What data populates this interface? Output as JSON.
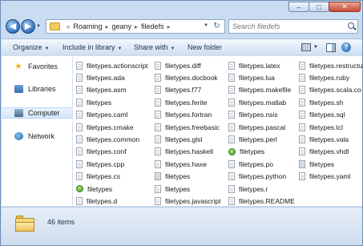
{
  "window": {
    "caption_buttons": {
      "minimize": "–",
      "maximize": "□",
      "close": "✕"
    }
  },
  "address": {
    "crumbs": [
      "Roaming",
      "geany",
      "filedefs"
    ],
    "search_placeholder": "Search filedefs"
  },
  "toolbar": {
    "organize": "Organize",
    "include_in_library": "Include in library",
    "share_with": "Share with",
    "new_folder": "New folder"
  },
  "nav": {
    "favorites": "Favorites",
    "libraries": "Libraries",
    "computer": "Computer",
    "network": "Network"
  },
  "files": [
    [
      {
        "name": "filetypes.actionscript",
        "icon": "file"
      },
      {
        "name": "filetypes.ada",
        "icon": "file"
      },
      {
        "name": "filetypes.asm",
        "icon": "file"
      },
      {
        "name": "filetypes",
        "icon": "file"
      },
      {
        "name": "filetypes.caml",
        "icon": "file"
      },
      {
        "name": "filetypes.cmake",
        "icon": "file"
      },
      {
        "name": "filetypes.common",
        "icon": "file"
      },
      {
        "name": "filetypes.conf",
        "icon": "file"
      },
      {
        "name": "filetypes.cpp",
        "icon": "file"
      },
      {
        "name": "filetypes.cs",
        "icon": "file"
      },
      {
        "name": "filetypes",
        "icon": "green"
      },
      {
        "name": "filetypes.d",
        "icon": "file"
      }
    ],
    [
      {
        "name": "filetypes.diff",
        "icon": "file"
      },
      {
        "name": "filetypes.docbook",
        "icon": "file"
      },
      {
        "name": "filetypes.f77",
        "icon": "file"
      },
      {
        "name": "filetypes.ferite",
        "icon": "file"
      },
      {
        "name": "filetypes.fortran",
        "icon": "file"
      },
      {
        "name": "filetypes.freebasic",
        "icon": "file"
      },
      {
        "name": "filetypes.glsl",
        "icon": "file"
      },
      {
        "name": "filetypes.haskell",
        "icon": "file"
      },
      {
        "name": "filetypes.haxe",
        "icon": "file"
      },
      {
        "name": "filetypes",
        "icon": "gear"
      },
      {
        "name": "filetypes",
        "icon": "file"
      },
      {
        "name": "filetypes.javascript",
        "icon": "file"
      }
    ],
    [
      {
        "name": "filetypes.latex",
        "icon": "file"
      },
      {
        "name": "filetypes.lua",
        "icon": "file"
      },
      {
        "name": "filetypes.makefile",
        "icon": "file"
      },
      {
        "name": "filetypes.matlab",
        "icon": "file"
      },
      {
        "name": "filetypes.nsis",
        "icon": "file"
      },
      {
        "name": "filetypes.pascal",
        "icon": "file"
      },
      {
        "name": "filetypes.perl",
        "icon": "file"
      },
      {
        "name": "filetypes",
        "icon": "green"
      },
      {
        "name": "filetypes.po",
        "icon": "file"
      },
      {
        "name": "filetypes.python",
        "icon": "file"
      },
      {
        "name": "filetypes.r",
        "icon": "file"
      },
      {
        "name": "filetypes.README",
        "icon": "file"
      }
    ],
    [
      {
        "name": "filetypes.restructu",
        "icon": "file"
      },
      {
        "name": "filetypes.ruby",
        "icon": "file"
      },
      {
        "name": "filetypes.scala.co",
        "icon": "file"
      },
      {
        "name": "filetypes.sh",
        "icon": "file"
      },
      {
        "name": "filetypes.sql",
        "icon": "file"
      },
      {
        "name": "filetypes.tcl",
        "icon": "file"
      },
      {
        "name": "filetypes.vala",
        "icon": "file"
      },
      {
        "name": "filetypes.vhdl",
        "icon": "file"
      },
      {
        "name": "filetypes",
        "icon": "gear"
      },
      {
        "name": "filetypes.yaml",
        "icon": "file"
      }
    ]
  ],
  "status": {
    "item_count": "46 items"
  }
}
